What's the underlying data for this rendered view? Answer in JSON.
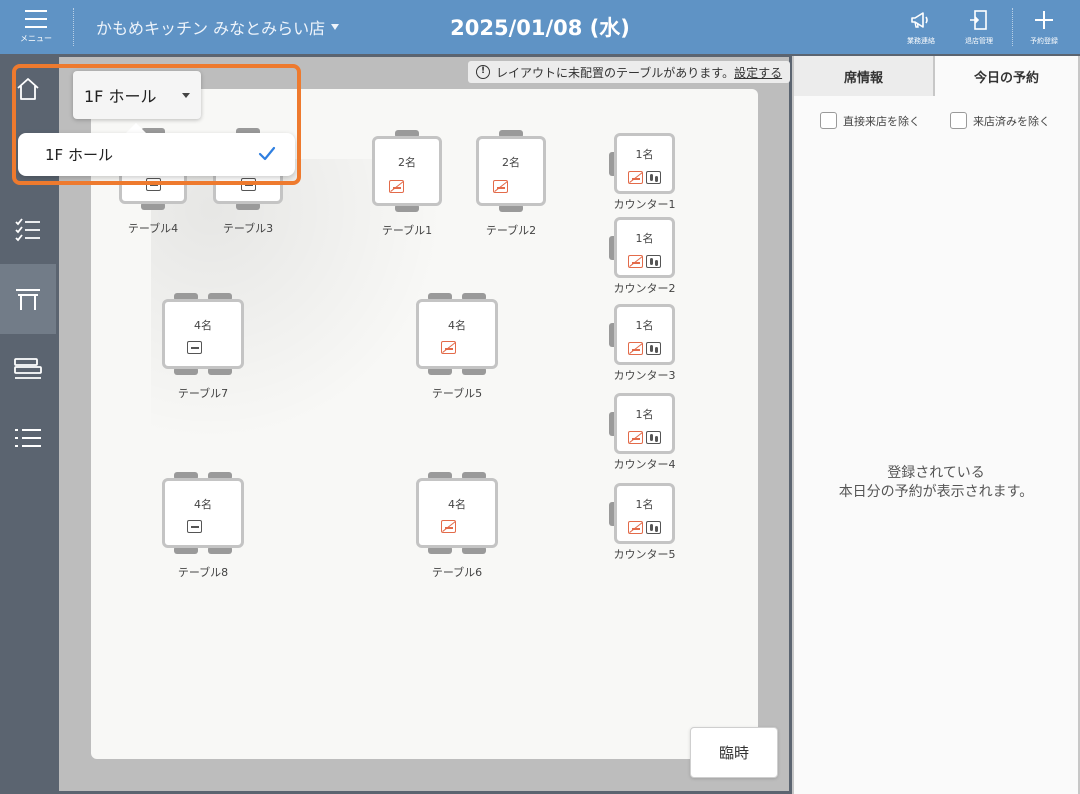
{
  "header": {
    "menu_label": "メニュー",
    "store_name": "かもめキッチン みなとみらい店",
    "date": "2025/01/08 (水)",
    "buttons": [
      {
        "label": "業務連絡",
        "icon": "megaphone-icon"
      },
      {
        "label": "退店管理",
        "icon": "exit-door-icon"
      },
      {
        "label": "予約登録",
        "icon": "plus-icon"
      }
    ]
  },
  "sidebar": {
    "items": [
      {
        "icon": "home-icon",
        "active": false
      },
      {
        "icon": "checklist-icon",
        "active": false
      },
      {
        "icon": "table-icon",
        "active": true
      },
      {
        "icon": "timeline-icon",
        "active": false
      },
      {
        "icon": "list-icon",
        "active": false
      }
    ]
  },
  "floor": {
    "selected": "1F ホール",
    "options": [
      {
        "label": "1F ホール",
        "selected": true
      }
    ],
    "notice_text": "レイアウトに未配置のテーブルがあります。",
    "notice_link": "設定する",
    "temp_button": "臨時"
  },
  "tables": [
    {
      "name": "テーブル4",
      "capacity": "",
      "icons": [
        "smoking"
      ]
    },
    {
      "name": "テーブル3",
      "capacity": "",
      "icons": [
        "smoking"
      ]
    },
    {
      "name": "テーブル1",
      "capacity": "2名",
      "icons": [
        "no-smoking"
      ]
    },
    {
      "name": "テーブル2",
      "capacity": "2名",
      "icons": [
        "no-smoking"
      ]
    },
    {
      "name": "テーブル7",
      "capacity": "4名",
      "icons": [
        "smoking"
      ]
    },
    {
      "name": "テーブル5",
      "capacity": "4名",
      "icons": [
        "no-smoking"
      ]
    },
    {
      "name": "テーブル8",
      "capacity": "4名",
      "icons": [
        "smoking"
      ]
    },
    {
      "name": "テーブル6",
      "capacity": "4名",
      "icons": [
        "no-smoking"
      ]
    },
    {
      "name": "カウンター1",
      "capacity": "1名",
      "icons": [
        "no-smoking",
        "shoes-off"
      ]
    },
    {
      "name": "カウンター2",
      "capacity": "1名",
      "icons": [
        "no-smoking",
        "shoes-off"
      ]
    },
    {
      "name": "カウンター3",
      "capacity": "1名",
      "icons": [
        "no-smoking",
        "shoes-off"
      ]
    },
    {
      "name": "カウンター4",
      "capacity": "1名",
      "icons": [
        "no-smoking",
        "shoes-off"
      ]
    },
    {
      "name": "カウンター5",
      "capacity": "1名",
      "icons": [
        "no-smoking",
        "shoes-off"
      ]
    }
  ],
  "right_panel": {
    "tabs": [
      {
        "label": "席情報",
        "active": false
      },
      {
        "label": "今日の予約",
        "active": true
      }
    ],
    "filters": [
      {
        "label": "直接来店を除く",
        "checked": false
      },
      {
        "label": "来店済みを除く",
        "checked": false
      }
    ],
    "empty_line1": "登録されている",
    "empty_line2": "本日分の予約が表示されます。"
  },
  "colors": {
    "header_bg": "#5f93c5",
    "sidebar_bg": "#5b6470",
    "highlight": "#ee7a2e",
    "check": "#2f7fe0",
    "no_smoking": "#e36b4a"
  }
}
